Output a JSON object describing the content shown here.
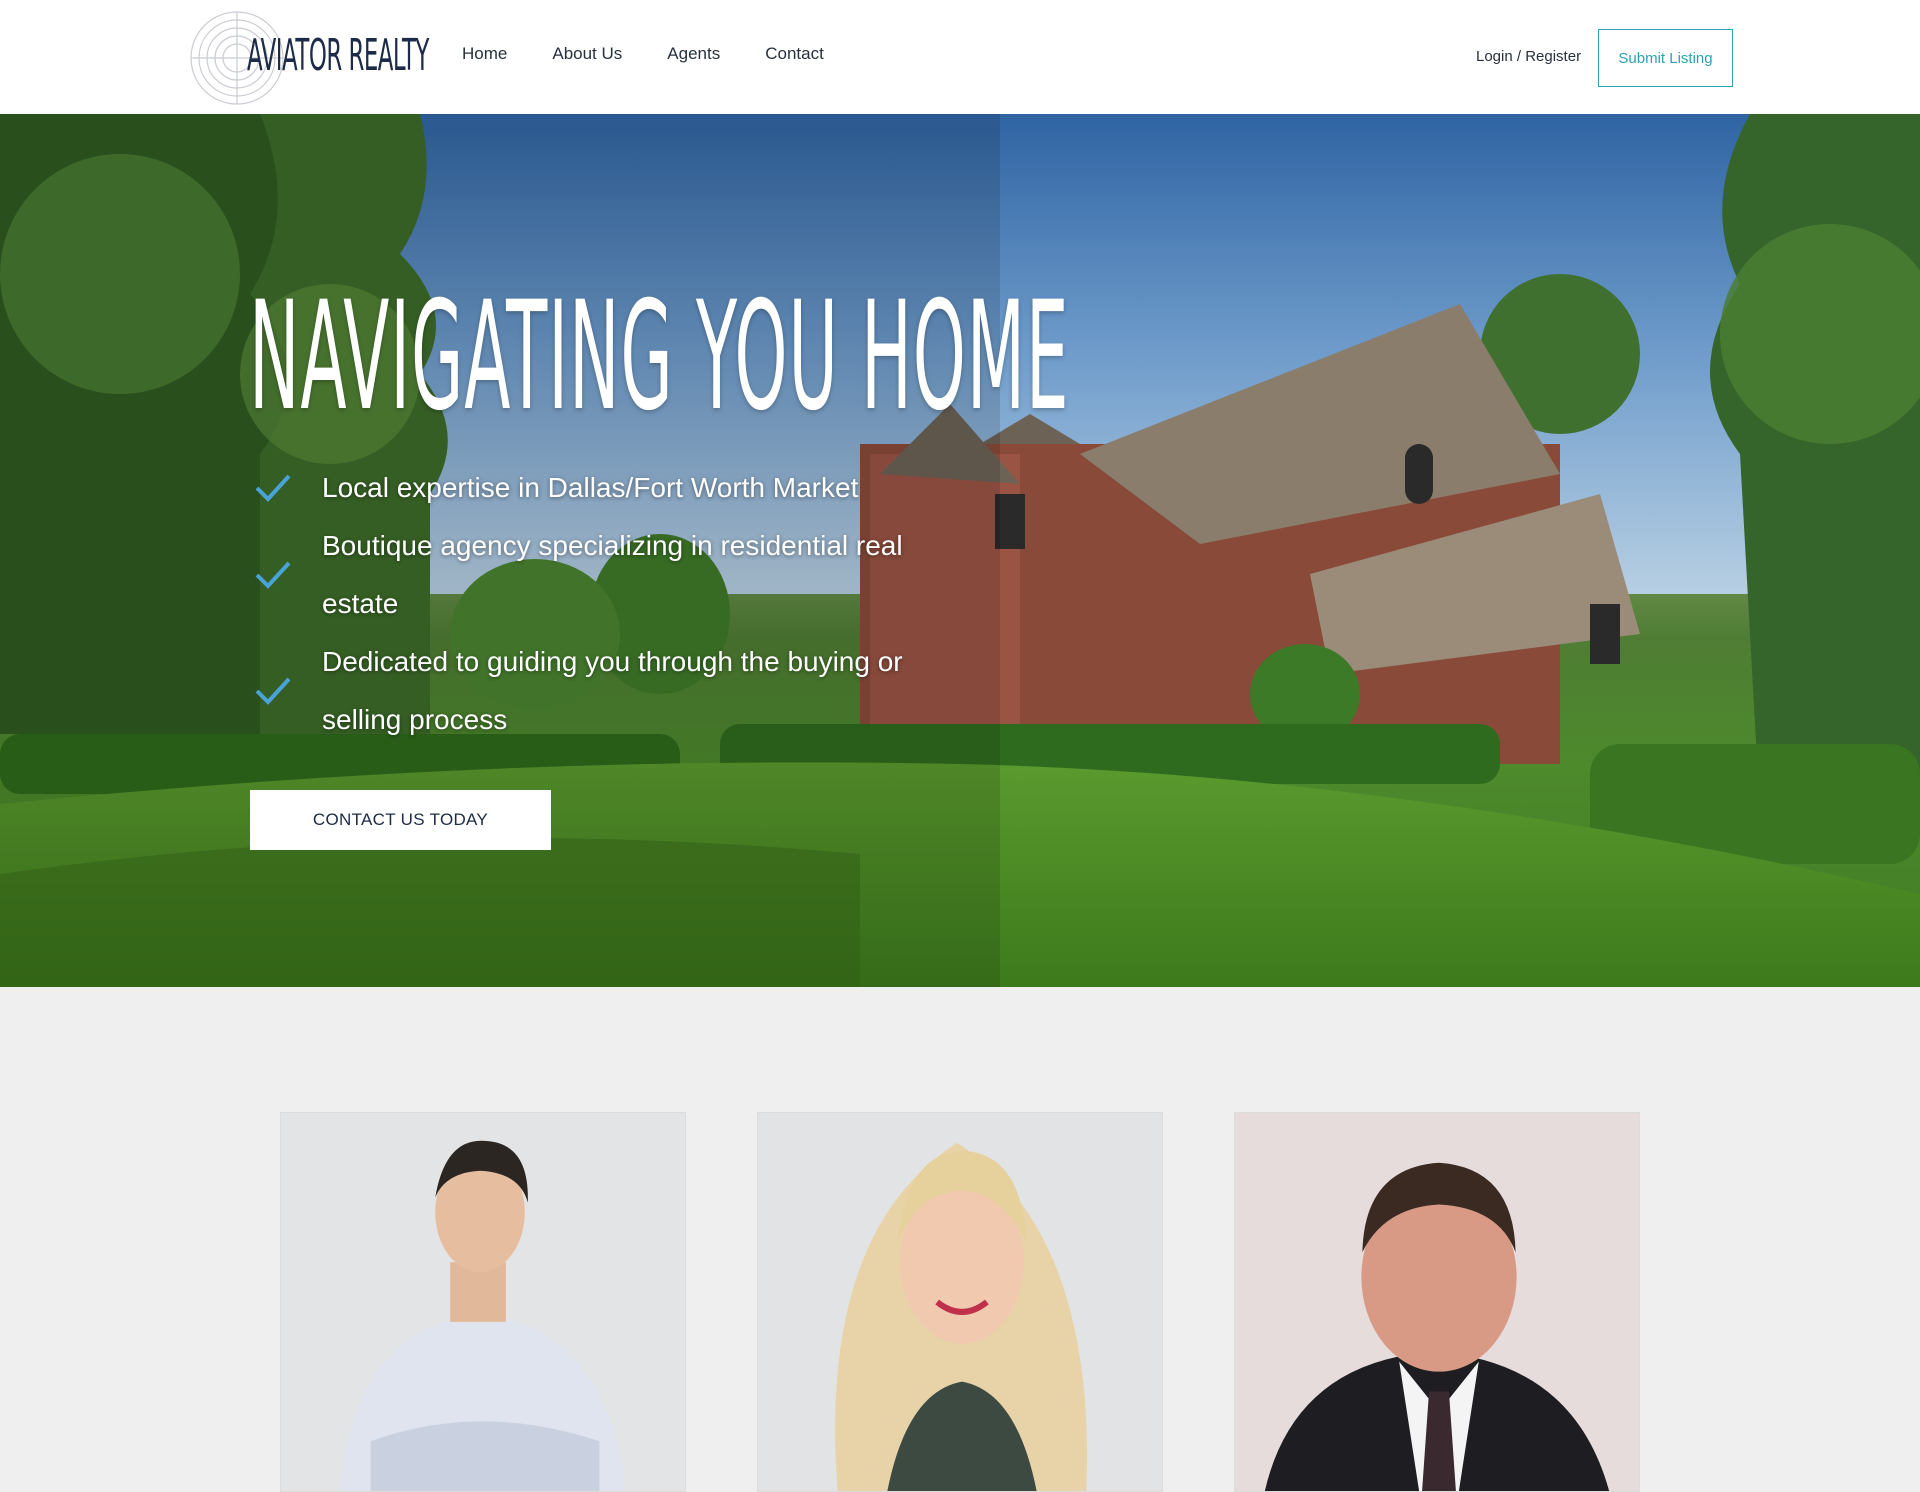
{
  "header": {
    "logo_text": "AVIATOR REALTY",
    "nav": [
      "Home",
      "About Us",
      "Agents",
      "Contact"
    ],
    "login_label": "Login / Register",
    "submit_label": "Submit Listing",
    "accent_color": "#2ea2b3"
  },
  "hero": {
    "title": "NAVIGATING YOU HOME",
    "checklist": [
      "Local expertise in Dallas/Fort Worth Market",
      "Boutique agency specializing in residential real estate",
      "Dedicated to guiding you through the buying or selling process"
    ],
    "check_color": "#4aa3d8",
    "cta_label": "CONTACT US TODAY"
  },
  "agents": {
    "photos": [
      "agent-photo-man-plaid-shirt",
      "agent-photo-woman-blonde",
      "agent-photo-man-suit"
    ]
  }
}
